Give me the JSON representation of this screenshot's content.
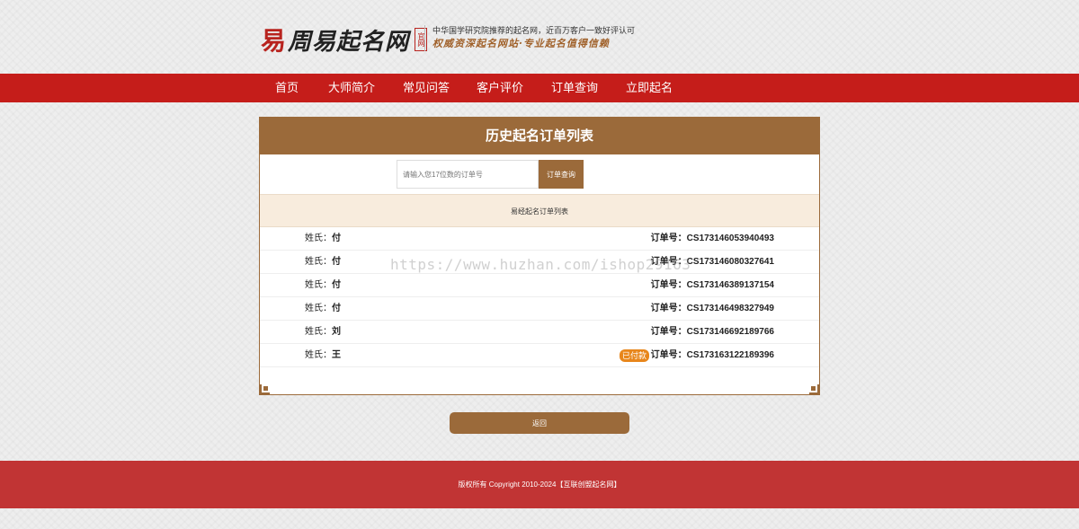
{
  "brand": {
    "logo_mark": "易",
    "logo_text": "周易起名网",
    "logo_seal": "官网",
    "slogan_line1": "中华国学研究院推荐的起名网，近百万客户一致好评认可",
    "slogan_line2": "权威资深起名网站·专业起名值得信赖"
  },
  "nav": {
    "items": [
      {
        "label": "首页"
      },
      {
        "label": "大师简介"
      },
      {
        "label": "常见问答"
      },
      {
        "label": "客户评价"
      },
      {
        "label": "订单查询"
      },
      {
        "label": "立即起名"
      }
    ]
  },
  "panel": {
    "title": "历史起名订单列表",
    "search": {
      "placeholder": "请输入您17位数的订单号",
      "button_label": "订单查询"
    },
    "list_header": "易经起名订单列表",
    "name_prefix": "姓氏：",
    "order_prefix": "订单号：",
    "rows": [
      {
        "surname": "付",
        "order_no": "CS173146053940493",
        "badge": ""
      },
      {
        "surname": "付",
        "order_no": "CS173146080327641",
        "badge": ""
      },
      {
        "surname": "付",
        "order_no": "CS173146389137154",
        "badge": ""
      },
      {
        "surname": "付",
        "order_no": "CS173146498327949",
        "badge": ""
      },
      {
        "surname": "刘",
        "order_no": "CS173146692189766",
        "badge": ""
      },
      {
        "surname": "王",
        "order_no": "CS173163122189396",
        "badge": "已付款"
      }
    ]
  },
  "back_button": "返回",
  "footer": {
    "text": "版权所有 Copyright 2010-2024【互联创盟起名网】"
  },
  "watermark": "https://www.huzhan.com/ishop29163",
  "colors": {
    "nav_red": "#c51d1a",
    "brown": "#9b6a3a",
    "footer_red": "#c13434",
    "badge_orange": "#e8861b"
  }
}
